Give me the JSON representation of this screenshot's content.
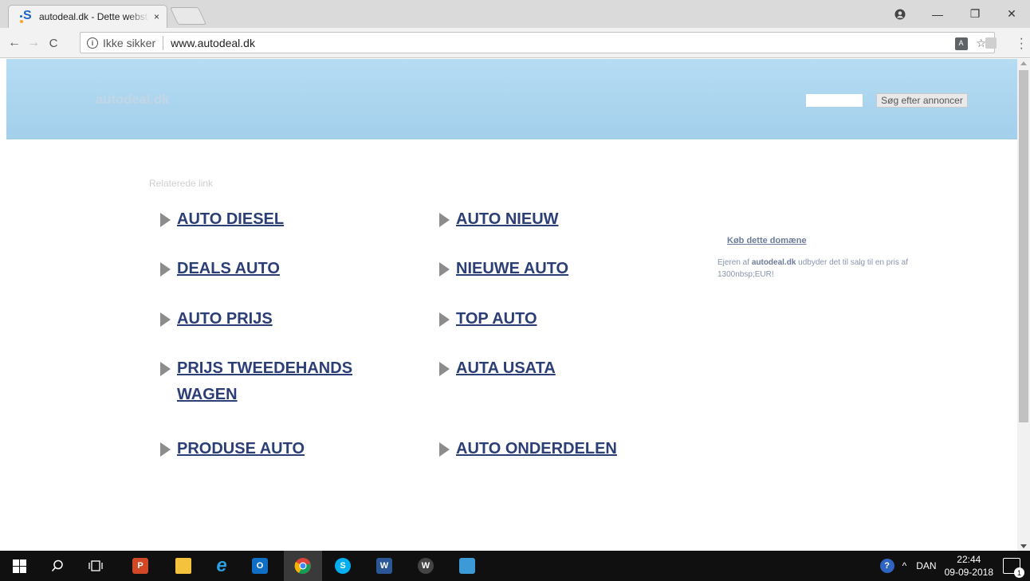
{
  "browser": {
    "tab_title": "autodeal.dk - Dette websted er til salg",
    "tab_close": "×",
    "security_label": "Ikke sikker",
    "url": "www.autodeal.dk",
    "window_controls": {
      "minimize": "—",
      "maximize": "❐",
      "close": "✕"
    }
  },
  "page": {
    "logo": "autodeal.dk",
    "search_button": "Søg efter annoncer",
    "search_placeholder": "",
    "related_label": "Relaterede link",
    "links_left": [
      "AUTO DIESEL",
      "DEALS AUTO",
      "AUTO PRIJS",
      "PRIJS TWEEDEHANDS WAGEN",
      "PRODUSE AUTO"
    ],
    "links_right": [
      "AUTO NIEUW",
      "NIEUWE AUTO",
      "TOP AUTO",
      "AUTA USATA",
      "AUTO ONDERDELEN"
    ],
    "buy_title": "Køb dette domæne",
    "buy_desc_prefix": "Ejeren af",
    "buy_desc_domain": "autodeal.dk",
    "buy_desc_suffix": "udbyder det til salg til en pris af 1300nbsp;EUR!"
  },
  "taskbar": {
    "language": "DAN",
    "time": "22:44",
    "date": "09-09-2018",
    "notification_count": "1",
    "apps": [
      "start",
      "search",
      "task-view",
      "powerpoint",
      "file-explorer",
      "internet-explorer",
      "outlook",
      "chrome",
      "skype",
      "word",
      "wunderlist",
      "app"
    ]
  },
  "colors": {
    "header_top": "#b5dcf3",
    "link": "#2b3e76",
    "taskbar": "#101010"
  }
}
